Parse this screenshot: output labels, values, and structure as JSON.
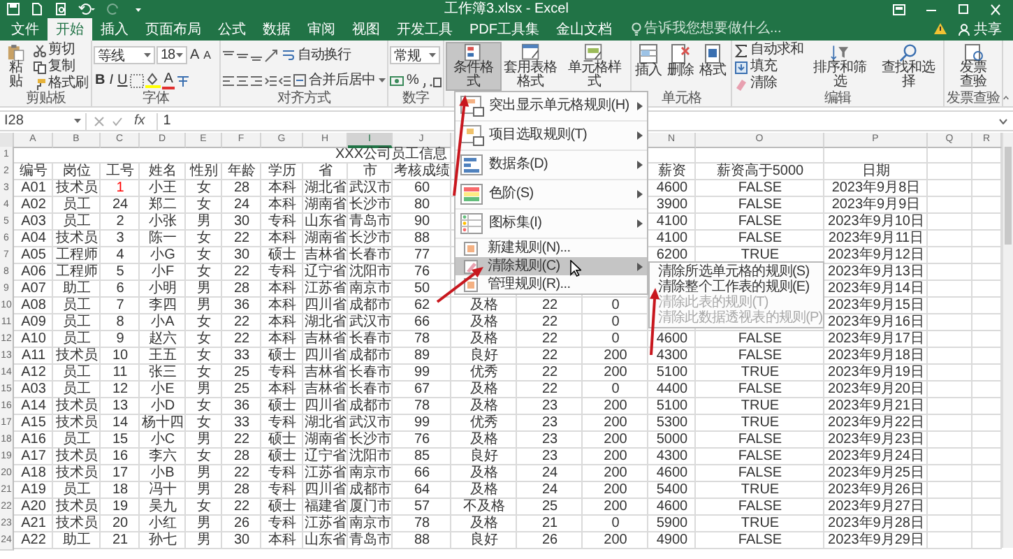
{
  "title_bar": {
    "title": "工作簿3.xlsx - Excel"
  },
  "tabs": [
    {
      "label": "文件",
      "selected": false
    },
    {
      "label": "开始",
      "selected": true
    },
    {
      "label": "插入",
      "selected": false
    },
    {
      "label": "页面布局",
      "selected": false
    },
    {
      "label": "公式",
      "selected": false
    },
    {
      "label": "数据",
      "selected": false
    },
    {
      "label": "审阅",
      "selected": false
    },
    {
      "label": "视图",
      "selected": false
    },
    {
      "label": "开发工具",
      "selected": false
    },
    {
      "label": "PDF工具集",
      "selected": false
    },
    {
      "label": "金山文档",
      "selected": false
    }
  ],
  "search": {
    "placeholder": "告诉我您想要做什么..."
  },
  "share": "共享",
  "ribbon": {
    "clipboard": {
      "paste": "粘贴",
      "cut": "剪切",
      "copy": "复制",
      "format_painter": "格式刷",
      "label": "剪贴板"
    },
    "font": {
      "name": "等线",
      "size": "18",
      "grow": "A",
      "shrink": "A",
      "bold": "B",
      "italic": "I",
      "underline": "U",
      "font_color": "A",
      "label": "字体"
    },
    "alignment": {
      "wrap": "自动换行",
      "merge": "合并后居中",
      "label": "对齐方式"
    },
    "number": {
      "format": "常规",
      "percent": "%",
      "label": "数字"
    },
    "styles": [
      {
        "label": "条件格式",
        "selected": true
      },
      {
        "label": "套用表格格式",
        "selected": false
      },
      {
        "label": "单元格样式",
        "selected": false
      }
    ],
    "cells": {
      "insert": "插入",
      "delete": "删除",
      "format": "格式",
      "label": "单元格"
    },
    "editing": {
      "autosum": "自动求和",
      "fill": "填充",
      "clear": "清除",
      "sort": "排序和筛选",
      "find": "查找和选择",
      "label": "编辑"
    },
    "invoice": {
      "button": "发票查验",
      "label": "发票查验"
    }
  },
  "formula_bar": {
    "name_box": "I28",
    "function_label": "fx",
    "value": "1"
  },
  "sheet": {
    "column_letters": [
      {
        "letter": "A",
        "selected": false
      },
      {
        "letter": "B",
        "selected": false
      },
      {
        "letter": "C",
        "selected": false
      },
      {
        "letter": "D",
        "selected": false
      },
      {
        "letter": "E",
        "selected": false
      },
      {
        "letter": "F",
        "selected": false
      },
      {
        "letter": "G",
        "selected": false
      },
      {
        "letter": "H",
        "selected": false
      },
      {
        "letter": "I",
        "selected": true
      },
      {
        "letter": "J",
        "selected": false
      },
      {
        "letter": "N",
        "selected": false
      },
      {
        "letter": "O",
        "selected": false
      },
      {
        "letter": "P",
        "selected": false
      },
      {
        "letter": "Q",
        "selected": false
      },
      {
        "letter": "R",
        "selected": false
      }
    ],
    "rows": [
      {
        "number": "1",
        "title": "XXX公司员工信息"
      },
      {
        "number": "2",
        "cells": [
          "编号",
          "岗位",
          "工号",
          "姓名",
          "性别",
          "年龄",
          "学历",
          "省",
          "市",
          "考核成绩",
          null,
          null,
          null,
          "薪资",
          "薪资高于5000",
          "日期"
        ]
      },
      {
        "number": "3",
        "cells": [
          "A01",
          "技术员",
          {
            "text": "1",
            "color": "#ff0000"
          },
          "小王",
          "女",
          "28",
          "本科",
          "湖北省",
          "武汉市",
          "60",
          null,
          null,
          null,
          "4600",
          "FALSE",
          "2023年9月8日"
        ]
      },
      {
        "number": "4",
        "cells": [
          "A02",
          "员工",
          "24",
          "郑二",
          "女",
          "24",
          "本科",
          "湖南省",
          "长沙市",
          "80",
          null,
          null,
          null,
          "3900",
          "FALSE",
          "2023年9月9日"
        ]
      },
      {
        "number": "5",
        "cells": [
          "A03",
          "员工",
          "2",
          "小张",
          "男",
          "30",
          "专科",
          "山东省",
          "青岛市",
          "90",
          null,
          null,
          null,
          "4100",
          "FALSE",
          "2023年9月10日"
        ]
      },
      {
        "number": "6",
        "cells": [
          "A04",
          "技术员",
          "3",
          "陈一",
          "女",
          "22",
          "本科",
          "湖南省",
          "长沙市",
          "88",
          null,
          null,
          null,
          "4100",
          "FALSE",
          "2023年9月11日"
        ]
      },
      {
        "number": "7",
        "cells": [
          "A05",
          "工程师",
          "4",
          "小G",
          "女",
          "30",
          "硕士",
          "吉林省",
          "长春市",
          "77",
          null,
          null,
          null,
          "6200",
          "TRUE",
          "2023年9月12日"
        ]
      },
      {
        "number": "8",
        "cells": [
          "A06",
          "工程师",
          "5",
          "小F",
          "女",
          "22",
          "专科",
          "辽宁省",
          "沈阳市",
          "76",
          null,
          null,
          null,
          null,
          null,
          "2023年9月13日"
        ]
      },
      {
        "number": "9",
        "cells": [
          "A07",
          "助工",
          "6",
          "小明",
          "男",
          "28",
          "本科",
          "江苏省",
          "南京市",
          "50",
          null,
          null,
          null,
          null,
          null,
          "2023年9月14日"
        ]
      },
      {
        "number": "10",
        "cells": [
          "A08",
          "员工",
          "7",
          "李四",
          "男",
          "36",
          "本科",
          "四川省",
          "成都市",
          "62",
          "及格",
          "22",
          "0",
          null,
          null,
          "2023年9月15日"
        ]
      },
      {
        "number": "11",
        "cells": [
          "A09",
          "员工",
          "8",
          "小A",
          "女",
          "22",
          "本科",
          "湖北省",
          "武汉市",
          "66",
          "及格",
          "22",
          "0",
          null,
          null,
          "2023年9月16日"
        ]
      },
      {
        "number": "12",
        "cells": [
          "A10",
          "员工",
          "9",
          "赵六",
          "女",
          "22",
          "本科",
          "吉林省",
          "长春市",
          "78",
          "及格",
          "22",
          "0",
          "4600",
          "FALSE",
          "2023年9月17日"
        ]
      },
      {
        "number": "13",
        "cells": [
          "A11",
          "技术员",
          "10",
          "王五",
          "女",
          "33",
          "硕士",
          "四川省",
          "成都市",
          "89",
          "良好",
          "22",
          "200",
          "4300",
          "FALSE",
          "2023年9月18日"
        ]
      },
      {
        "number": "14",
        "cells": [
          "A12",
          "员工",
          "11",
          "张三",
          "女",
          "25",
          "专科",
          "吉林省",
          "长春市",
          "99",
          "优秀",
          "22",
          "200",
          "5100",
          "TRUE",
          "2023年9月19日"
        ]
      },
      {
        "number": "15",
        "cells": [
          "A03",
          "员工",
          "12",
          "小E",
          "男",
          "25",
          "本科",
          "吉林省",
          "长春市",
          "67",
          "及格",
          "22",
          "0",
          "4400",
          "FALSE",
          "2023年9月20日"
        ]
      },
      {
        "number": "16",
        "cells": [
          "A14",
          "技术员",
          "13",
          "小D",
          "女",
          "36",
          "硕士",
          "四川省",
          "成都市",
          "78",
          "及格",
          "23",
          "200",
          "5100",
          "TRUE",
          "2023年9月21日"
        ]
      },
      {
        "number": "17",
        "cells": [
          "A15",
          "技术员",
          "14",
          "杨十四",
          "女",
          "33",
          "专科",
          "湖北省",
          "武汉市",
          "99",
          "优秀",
          "23",
          "200",
          "5300",
          "TRUE",
          "2023年9月22日"
        ]
      },
      {
        "number": "18",
        "cells": [
          "A16",
          "员工",
          "15",
          "小C",
          "男",
          "22",
          "硕士",
          "湖南省",
          "长沙市",
          "76",
          "及格",
          "23",
          "200",
          "5000",
          "FALSE",
          "2023年9月23日"
        ]
      },
      {
        "number": "19",
        "cells": [
          "A17",
          "技术员",
          "16",
          "李六",
          "女",
          "28",
          "硕士",
          "辽宁省",
          "沈阳市",
          "85",
          "良好",
          "23",
          "200",
          "4300",
          "FALSE",
          "2023年9月24日"
        ]
      },
      {
        "number": "20",
        "cells": [
          "A18",
          "技术员",
          "17",
          "小B",
          "男",
          "22",
          "专科",
          "江苏省",
          "南京市",
          "66",
          "及格",
          "24",
          "200",
          "4600",
          "FALSE",
          "2023年9月25日"
        ]
      },
      {
        "number": "21",
        "cells": [
          "A19",
          "员工",
          "18",
          "冯十",
          "男",
          "28",
          "专科",
          "四川省",
          "成都市",
          "64",
          "及格",
          "24",
          "200",
          "5400",
          "TRUE",
          "2023年9月26日"
        ]
      },
      {
        "number": "22",
        "cells": [
          "A20",
          "技术员",
          "19",
          "吴九",
          "女",
          "22",
          "硕士",
          "福建省",
          "厦门市",
          "57",
          "不及格",
          "25",
          "200",
          "4600",
          "FALSE",
          "2023年9月27日"
        ]
      },
      {
        "number": "23",
        "cells": [
          "A21",
          "技术员",
          "20",
          "小红",
          "男",
          "26",
          "专科",
          "江苏省",
          "南京市",
          "78",
          "及格",
          "21",
          "0",
          "5900",
          "TRUE",
          "2023年9月28日"
        ]
      },
      {
        "number": "24",
        "cells": [
          "A22",
          "助工",
          "21",
          "孙七",
          "男",
          "30",
          "本科",
          "山东省",
          "青岛市",
          "88",
          "良好",
          "26",
          "200",
          "4900",
          "FALSE",
          "2023年9月29日"
        ]
      }
    ]
  },
  "menu": {
    "items": [
      {
        "label": "突出显示单元格规则(H)",
        "kind": "large",
        "has_submenu": true,
        "selected": false
      },
      {
        "label": "项目选取规则(T)",
        "kind": "large",
        "has_submenu": true,
        "selected": false
      },
      {
        "label": "数据条(D)",
        "kind": "large",
        "has_submenu": true,
        "selected": false
      },
      {
        "label": "色阶(S)",
        "kind": "large",
        "has_submenu": true,
        "selected": false
      },
      {
        "label": "图标集(I)",
        "kind": "large",
        "has_submenu": true,
        "selected": false
      },
      {
        "label": "新建规则(N)...",
        "kind": "small",
        "has_submenu": false,
        "selected": false
      },
      {
        "label": "清除规则(C)",
        "kind": "small",
        "has_submenu": true,
        "selected": true
      },
      {
        "label": "管理规则(R)...",
        "kind": "small",
        "has_submenu": false,
        "selected": false
      }
    ]
  },
  "submenu": {
    "items": [
      {
        "label": "清除所选单元格的规则(S)",
        "disabled": false
      },
      {
        "label": "清除整个工作表的规则(E)",
        "disabled": false
      },
      {
        "label": "清除此表的规则(T)",
        "disabled": true
      },
      {
        "label": "清除此数据透视表的规则(P)",
        "disabled": true
      }
    ]
  }
}
